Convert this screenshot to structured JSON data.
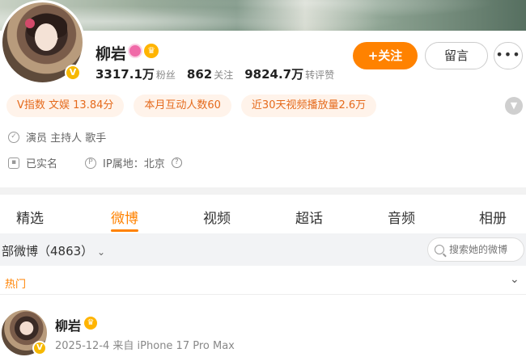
{
  "profile": {
    "name": "柳岩",
    "verified_badge": "V",
    "stats": [
      {
        "num": "3317.1万",
        "label": "粉丝"
      },
      {
        "num": "862",
        "label": "关注"
      },
      {
        "num": "9824.7万",
        "label": "转评赞"
      }
    ],
    "follow_label": "+关注",
    "message_label": "留言",
    "more_label": "•••"
  },
  "tags": [
    "V指数 文娱 13.84分",
    "本月互动人数60",
    "近30天视频播放量2.6万"
  ],
  "info": {
    "roles": "演员 主持人 歌手",
    "realname": "已实名",
    "ip": "IP属地：北京"
  },
  "tabs": [
    "精选",
    "微博",
    "视频",
    "超话",
    "音频",
    "相册"
  ],
  "active_tab": "微博",
  "filter": {
    "label": "部微博（4863）",
    "search_placeholder": "搜索她的微博"
  },
  "hot_label": "热门",
  "post": {
    "author": "柳岩",
    "meta": "2025-12-4  来自 iPhone 17 Pro Max"
  },
  "colors": {
    "accent": "#ff8200",
    "tag_bg": "#fff3ea",
    "tag_text": "#e56a1c",
    "badge": "#f6b800"
  }
}
